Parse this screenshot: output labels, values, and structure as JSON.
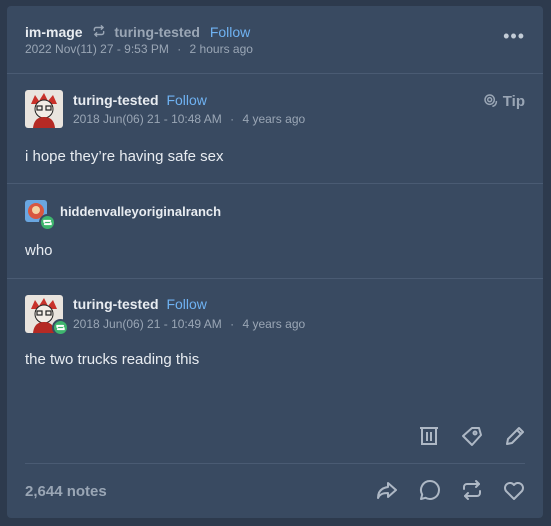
{
  "header": {
    "username": "im-mage",
    "reblogged_from": "turing-tested",
    "follow_label": "Follow",
    "timestamp": "2022 Nov(11) 27 - 9:53 PM",
    "relative_time": "2 hours ago",
    "more_label": "•••"
  },
  "tip_label": "Tip",
  "posts": [
    {
      "username": "turing-tested",
      "follow_label": "Follow",
      "timestamp": "2018 Jun(06) 21 - 10:48 AM",
      "relative_time": "4 years ago",
      "text": "i hope they’re having safe sex"
    },
    {
      "username": "hiddenvalleyoriginalranch",
      "text": "who"
    },
    {
      "username": "turing-tested",
      "follow_label": "Follow",
      "timestamp": "2018 Jun(06) 21 - 10:49 AM",
      "relative_time": "4 years ago",
      "text": "the two trucks reading this"
    }
  ],
  "footer": {
    "notes": "2,644 notes"
  },
  "separator": "·",
  "colors": {
    "background": "#2d3a4d",
    "card": "#394a61",
    "link": "#6fb2f2",
    "reblog_green": "#3eb56e"
  }
}
